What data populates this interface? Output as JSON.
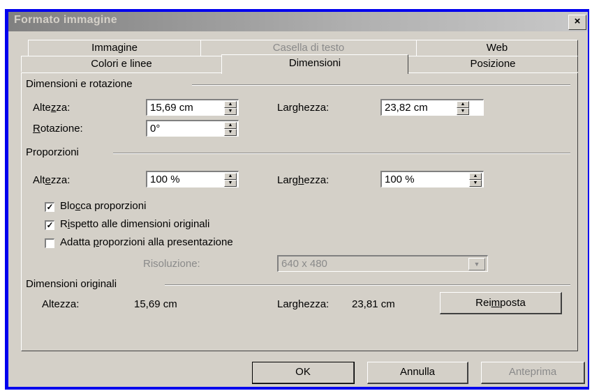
{
  "window": {
    "title": "Formato immagine",
    "close_label": "×"
  },
  "tabs_row1": [
    {
      "label": "Immagine",
      "enabled": true
    },
    {
      "label": "Casella di testo",
      "enabled": false
    },
    {
      "label": "Web",
      "enabled": true
    }
  ],
  "tabs_row2": [
    {
      "label": "Colori e linee"
    },
    {
      "label": "Dimensioni"
    },
    {
      "label": "Posizione"
    }
  ],
  "sections": {
    "size_rotation": "Dimensioni e rotazione",
    "proportions": "Proporzioni",
    "original": "Dimensioni originali"
  },
  "size": {
    "height_label": "Altezza:",
    "height_value": "15,69 cm",
    "width_label": "Larghezza:",
    "width_value": "23,82 cm",
    "rotation_label": "Rotazione:",
    "rotation_value": "0°"
  },
  "scale": {
    "height_label": "Altezza:",
    "height_value": "100 %",
    "width_label": "Larghezza:",
    "width_value": "100 %"
  },
  "checkboxes": [
    {
      "label": "Blocca proporzioni",
      "checked": true
    },
    {
      "label": "Rispetto alle dimensioni originali",
      "checked": true
    },
    {
      "label": "Adatta proporzioni alla presentazione",
      "checked": false
    }
  ],
  "resolution": {
    "label": "Risoluzione:",
    "value": "640 x 480"
  },
  "original": {
    "height_label": "Altezza:",
    "height_value": "15,69 cm",
    "width_label": "Larghezza:",
    "width_value": "23,81 cm",
    "reset_label": "Reimposta"
  },
  "buttons": {
    "ok": "OK",
    "cancel": "Annulla",
    "preview": "Anteprima"
  },
  "colors": {
    "frame": "#0000ee",
    "face": "#d4d0c8",
    "disabled": "#8a8a8a"
  }
}
